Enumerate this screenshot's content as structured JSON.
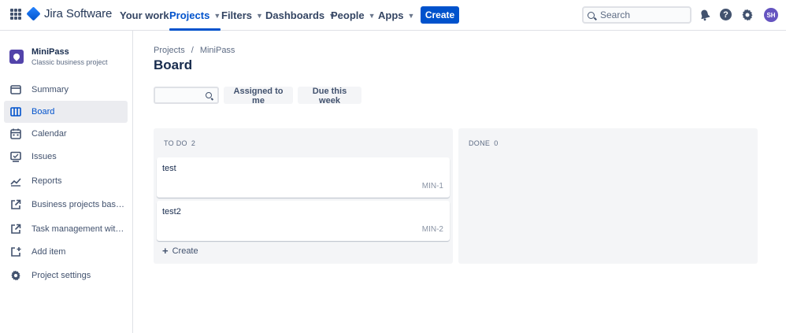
{
  "app": {
    "name": "Jira Software"
  },
  "nav": {
    "your_work": "Your work",
    "projects": "Projects",
    "filters": "Filters",
    "dashboards": "Dashboards",
    "people": "People",
    "apps": "Apps",
    "create": "Create",
    "search_placeholder": "Search",
    "avatar_initials": "SH"
  },
  "sidebar": {
    "project_name": "MiniPass",
    "project_type": "Classic business project",
    "items": [
      {
        "label": "Summary",
        "icon": "summary-icon"
      },
      {
        "label": "Board",
        "icon": "board-icon",
        "active": true
      },
      {
        "label": "Calendar",
        "icon": "calendar-icon"
      },
      {
        "label": "Issues",
        "icon": "issues-icon"
      },
      {
        "label": "Reports",
        "icon": "reports-icon"
      },
      {
        "label": "Business projects basics",
        "icon": "external-link-icon"
      },
      {
        "label": "Task management with ...",
        "icon": "external-link-icon"
      },
      {
        "label": "Add item",
        "icon": "add-item-icon"
      },
      {
        "label": "Project settings",
        "icon": "gear-icon"
      }
    ]
  },
  "main": {
    "breadcrumb": [
      "Projects",
      "MiniPass"
    ],
    "breadcrumb_sep": "/",
    "title": "Board",
    "filters": {
      "assigned": "Assigned to me",
      "due": "Due this week"
    },
    "columns": [
      {
        "name": "TO DO",
        "count": "2",
        "cards": [
          {
            "title": "test",
            "key": "MIN-1"
          },
          {
            "title": "test2",
            "key": "MIN-2"
          }
        ],
        "create_label": "Create"
      },
      {
        "name": "DONE",
        "count": "0",
        "cards": []
      }
    ]
  },
  "colors": {
    "primary": "#0052CC",
    "avatar": "#6554C0",
    "project_icon": "#5243AA"
  }
}
